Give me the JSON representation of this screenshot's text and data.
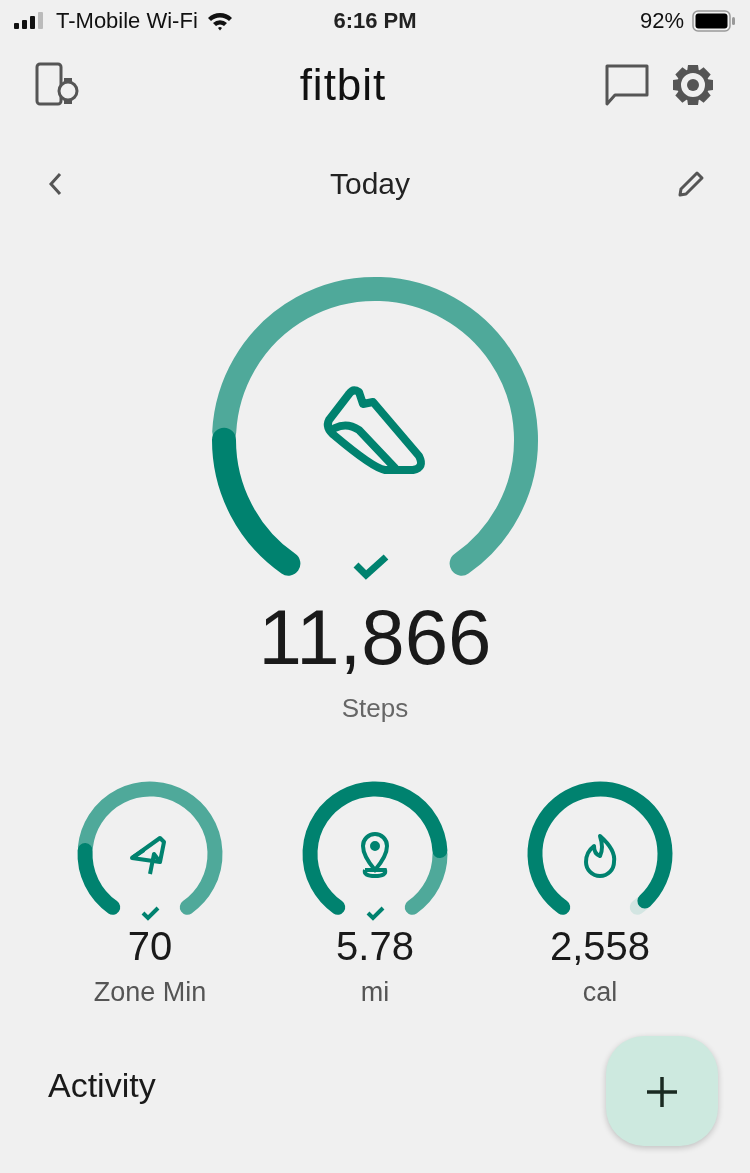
{
  "status_bar": {
    "carrier": "T-Mobile Wi-Fi",
    "time": "6:16 PM",
    "battery": "92%"
  },
  "header": {
    "logo": "fitbit"
  },
  "date_nav": {
    "title": "Today"
  },
  "main_stat": {
    "value": "11,866",
    "label": "Steps",
    "goal_met": true,
    "kind": "steps"
  },
  "stats": [
    {
      "value": "70",
      "label": "Zone Min",
      "goal_met": true,
      "kind": "zone"
    },
    {
      "value": "5.78",
      "label": "mi",
      "goal_met": true,
      "kind": "distance"
    },
    {
      "value": "2,558",
      "label": "cal",
      "goal_met": false,
      "kind": "calories"
    }
  ],
  "section": {
    "title": "Activity"
  }
}
